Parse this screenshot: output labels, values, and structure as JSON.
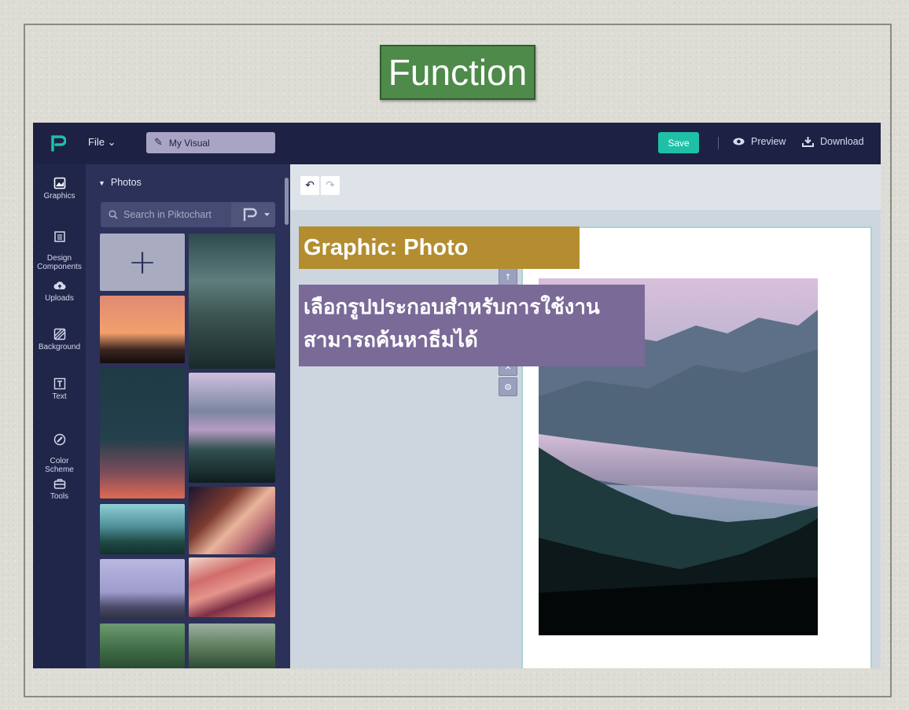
{
  "slide": {
    "title": "Function"
  },
  "app": {
    "file_menu": "File",
    "document_title": "My Visual",
    "save_label": "Save",
    "preview_label": "Preview",
    "download_label": "Download"
  },
  "sidebar": {
    "items": [
      {
        "label": "Graphics",
        "icon": "image-icon"
      },
      {
        "label": "Design\nComponents",
        "icon": "grid-icon"
      },
      {
        "label": "Uploads",
        "icon": "cloud-upload-icon"
      },
      {
        "label": "Background",
        "icon": "hatched-square-icon"
      },
      {
        "label": "Text",
        "icon": "text-icon"
      },
      {
        "label": "Color\nScheme",
        "icon": "palette-icon"
      },
      {
        "label": "Tools",
        "icon": "toolbox-icon"
      }
    ]
  },
  "panel": {
    "section": "Photos",
    "search_placeholder": "Search in Piktochart"
  },
  "annotations": {
    "graphic_label": "Graphic: Photo",
    "description": "เลือกรูปประกอบสำหรับการใช้งาน สามารถค้นหาธีมได้"
  },
  "colors": {
    "slide_title_bg": "#4e8a4a",
    "graphic_label_bg": "#b38d2f",
    "description_bg": "#7a6a98",
    "topbar": "#1d2244",
    "save_button": "#1ec0a6"
  }
}
